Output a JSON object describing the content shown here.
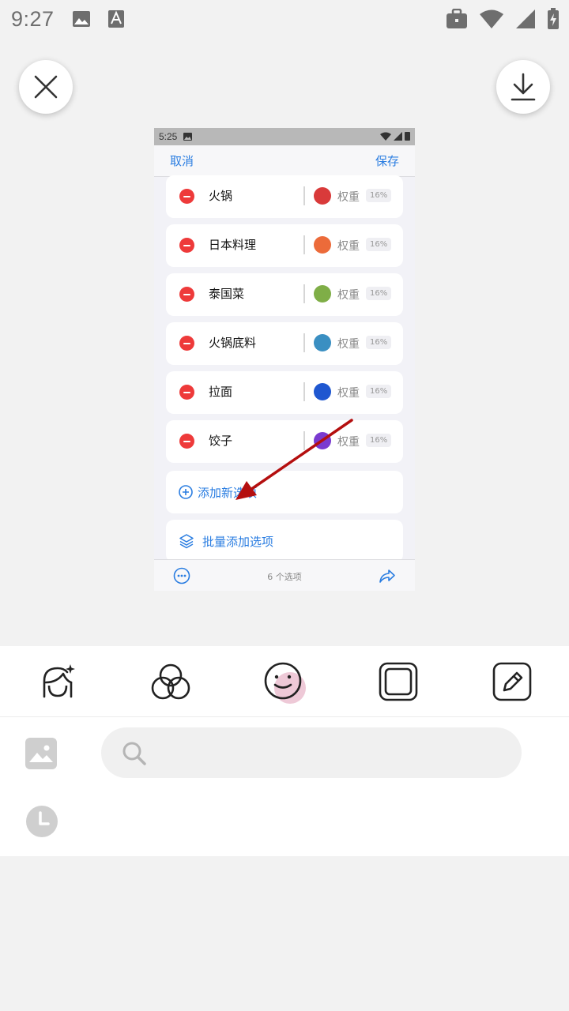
{
  "status_bar": {
    "time": "9:27",
    "icons": [
      "image-icon",
      "font-icon",
      "briefcase-icon",
      "wifi-icon",
      "signal-icon",
      "battery-charging-icon"
    ]
  },
  "actions": {
    "close_icon": "close-icon",
    "download_icon": "download-icon"
  },
  "screenshot": {
    "status_time": "5:25",
    "nav": {
      "cancel": "取消",
      "save": "保存"
    },
    "items": [
      {
        "name": "火锅",
        "weight_label": "权重",
        "percent": "16%",
        "color": "#d93a3a"
      },
      {
        "name": "日本料理",
        "weight_label": "权重",
        "percent": "16%",
        "color": "#ec6b3a"
      },
      {
        "name": "泰国菜",
        "weight_label": "权重",
        "percent": "16%",
        "color": "#7fae47"
      },
      {
        "name": "火锅底料",
        "weight_label": "权重",
        "percent": "16%",
        "color": "#3a8fc2"
      },
      {
        "name": "拉面",
        "weight_label": "权重",
        "percent": "16%",
        "color": "#1f57d0"
      },
      {
        "name": "饺子",
        "weight_label": "权重",
        "percent": "16%",
        "color": "#7a3ad0"
      }
    ],
    "add_option": "添加新选项",
    "batch_add": "批量添加选项",
    "option_count": "6 个选项",
    "accent_color": "#2a7de1",
    "annotation_arrow_color": "#b40f0f"
  },
  "editor_tools": [
    "face-sparkle-icon",
    "filter-circles-icon",
    "sticker-smile-icon",
    "frame-icon",
    "edit-pen-icon"
  ],
  "sticker_panel": {
    "search_placeholder": "",
    "gallery_icon": "gallery-icon",
    "recent_icon": "recent-clock-icon"
  }
}
